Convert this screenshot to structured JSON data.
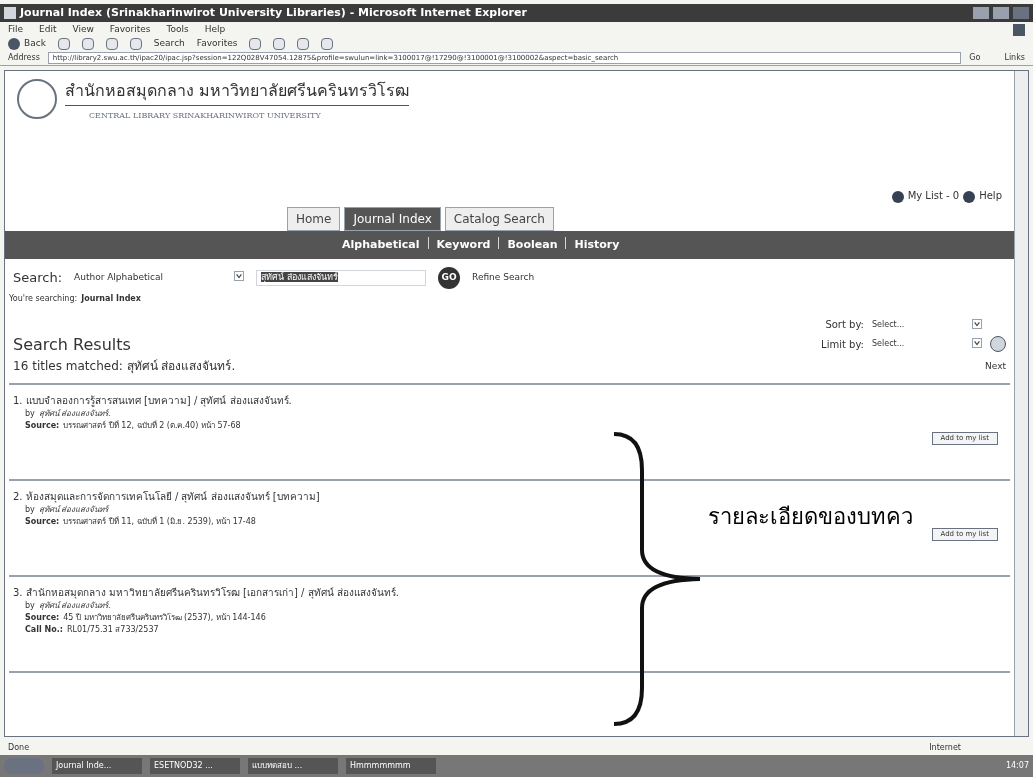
{
  "window": {
    "title": "Journal Index (Srinakharinwirot University Libraries) - Microsoft Internet Explorer"
  },
  "menu": [
    "File",
    "Edit",
    "View",
    "Favorites",
    "Tools",
    "Help"
  ],
  "toolbar": {
    "back": "Back",
    "search": "Search",
    "favorites": "Favorites"
  },
  "address": {
    "label": "Address",
    "url": "http://library2.swu.ac.th/ipac20/ipac.jsp?session=122Q028V47054.12875&profile=swulun=link=3100017@!17290@!3100001@!3100002&aspect=basic_search",
    "go": "Go",
    "links": "Links"
  },
  "header": {
    "title_th": "สำนักหอสมุดกลาง  มหาวิทยาลัยศรีนครินทรวิโรฒ",
    "title_en": "CENTRAL LIBRARY SRINAKHARINWIROT UNIVERSITY",
    "my_list": "My List - 0",
    "help": "Help"
  },
  "tabs": [
    {
      "label": "Home",
      "selected": false
    },
    {
      "label": "Journal Index",
      "selected": true
    },
    {
      "label": "Catalog Search",
      "selected": false
    }
  ],
  "subnav": [
    "Alphabetical",
    "Keyword",
    "Boolean",
    "History"
  ],
  "search": {
    "label": "Search:",
    "type": "Author Alphabetical",
    "value": "สุทัศน์ ส่องแสงจันทร์",
    "go": "GO",
    "refine": "Refine Search",
    "context_label": "You're searching:",
    "context": "Journal Index"
  },
  "results": {
    "heading": "Search Results",
    "count": "16",
    "matched": "titles matched: สุทัศน์ ส่องแสงจันทร์.",
    "sort_label": "Sort by:",
    "sort_value": "Select...",
    "limit_label": "Limit by:",
    "limit_value": "Select...",
    "next": "Next",
    "items": [
      {
        "title": "1. แบบจำลองการรู้สารสนเทศ [บทความ] / สุทัศน์ ส่องแสงจันทร์.",
        "by_label": "by",
        "by": "สุทัศน์ ส่องแสงจันทร์.",
        "source_label": "Source:",
        "source": "บรรณศาสตร์ ปีที่ 12, ฉบับที่ 2 (ต.ค.40) หน้า 57-68",
        "button": "Add to my list"
      },
      {
        "title": "2. ห้องสมุดและการจัดการเทคโนโลยี / สุทัศน์ ส่องแสงจันทร์ [บทความ]",
        "by_label": "by",
        "by": "สุทัศน์ ส่องแสงจันทร์",
        "source_label": "Source:",
        "source": "บรรณศาสตร์ ปีที่ 11, ฉบับที่ 1 (มิ.ย. 2539), หน้า 17-48",
        "button": "Add to my list"
      },
      {
        "title": "3. สำนักหอสมุดกลาง มหาวิทยาลัยศรีนครินทรวิโรฒ [เอกสารเก่า] / สุทัศน์ ส่องแสงจันทร์.",
        "by_label": "by",
        "by": "สุทัศน์ ส่องแสงจันทร์.",
        "source_label": "Source:",
        "source": "45 ปี มหาวิทยาลัยศรีนครินทรวิโรฒ (2537), หน้า 144-146",
        "call_label": "Call No.:",
        "call_no": "RL01/75.31 ส733/2537"
      }
    ]
  },
  "annotation": "รายละเอียดของบทคว",
  "status_bar": {
    "left": "Done",
    "right": "Internet"
  },
  "taskbar": {
    "items": [
      "Journal Inde...",
      "ESETNOD32 ...",
      "แบบทดสอบ ...",
      "Hmmmmmmm"
    ],
    "clock": "14:07"
  }
}
